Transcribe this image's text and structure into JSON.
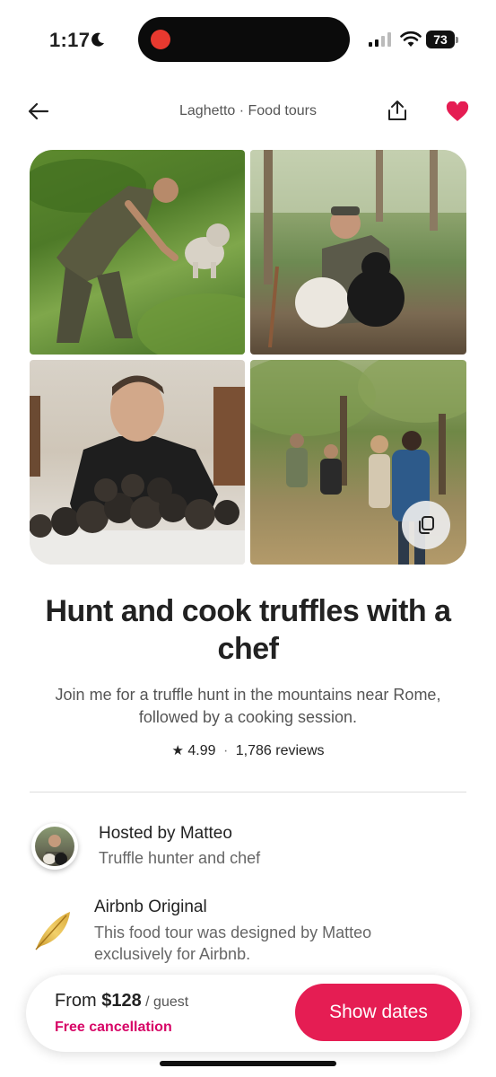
{
  "status_bar": {
    "time": "1:17",
    "battery": "73",
    "icons": [
      "moon-icon",
      "recording-dot",
      "signal-icon",
      "wifi-icon",
      "battery-icon"
    ]
  },
  "nav": {
    "title": "Laghetto · Food tours",
    "icons": [
      "back-arrow-icon",
      "share-icon",
      "heart-icon"
    ],
    "favorite_color": "#e51d53"
  },
  "gallery": {
    "photos": [
      "truffle-hunter-with-dog",
      "host-with-dogs",
      "chef-with-truffles",
      "group-walking-forest"
    ],
    "more_photos_icon": "gallery-stack-icon"
  },
  "experience": {
    "title": "Hunt and cook truffles with a chef",
    "description": "Join me for a truffle hunt in the mountains near Rome, followed by a cooking session.",
    "rating": "4.99",
    "separator": "·",
    "reviews": "1,786 reviews"
  },
  "host": {
    "label": "Hosted by Matteo",
    "role": "Truffle hunter and chef"
  },
  "original": {
    "title": "Airbnb Original",
    "description": "This food tour was designed by Matteo exclusively for Airbnb.",
    "icon": "golden-feather-icon"
  },
  "booking": {
    "price_prefix": "From ",
    "price": "$128",
    "price_unit": " / guest",
    "cancellation": "Free cancellation",
    "button": "Show dates",
    "button_color": "#e51d53",
    "cancellation_color": "#d70466"
  }
}
